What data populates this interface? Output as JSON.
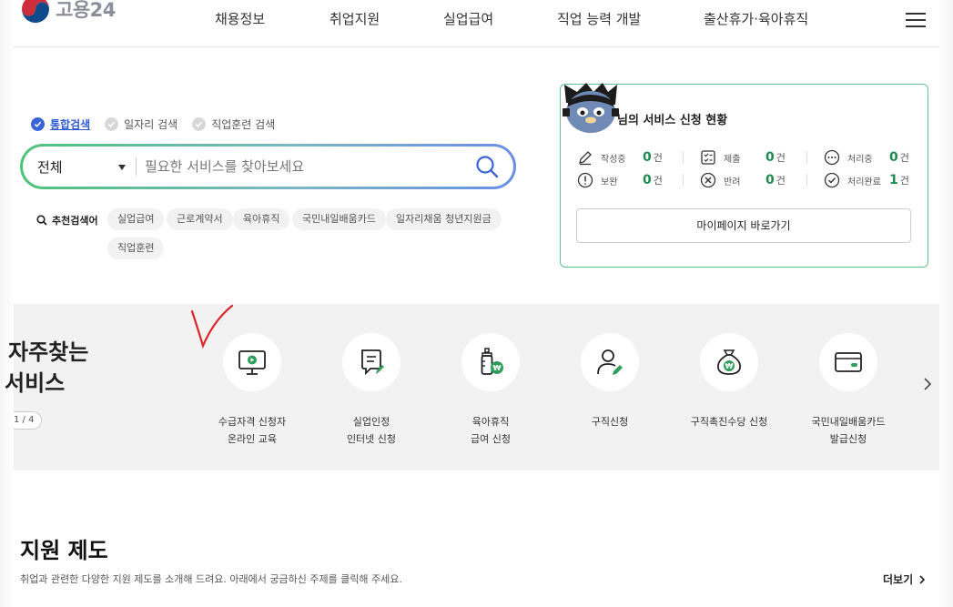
{
  "header": {
    "logo_text": "고용24",
    "nav": [
      "채용정보",
      "취업지원",
      "실업급여",
      "직업 능력 개발",
      "출산휴가·육아휴직"
    ]
  },
  "search": {
    "tabs": [
      {
        "label": "통합검색",
        "active": true
      },
      {
        "label": "일자리 검색",
        "active": false
      },
      {
        "label": "직업훈련 검색",
        "active": false
      }
    ],
    "select_value": "전체",
    "placeholder": "필요한 서비스를 찾아보세요",
    "recommend_label": "추천검색어",
    "recommend": [
      "실업급여",
      "근로계약서",
      "육아휴직",
      "국민내일배움카드",
      "일자리채움 청년지원금",
      "직업훈련"
    ]
  },
  "status": {
    "title": "님의 서비스 신청 현황",
    "unit": "건",
    "items": [
      {
        "label": "작성중",
        "value": "0"
      },
      {
        "label": "제출",
        "value": "0"
      },
      {
        "label": "처리중",
        "value": "0"
      },
      {
        "label": "보완",
        "value": "0"
      },
      {
        "label": "반려",
        "value": "0"
      },
      {
        "label": "처리완료",
        "value": "1"
      }
    ],
    "mypage_button": "마이페이지 바로가기"
  },
  "frequent": {
    "title_line1": "자주찾는",
    "title_line2": "서비스",
    "pager": "1 / 4",
    "services": [
      {
        "label": "수급자격 신청자\n온라인 교육",
        "icon": "monitor-play-icon"
      },
      {
        "label": "실업인정\n인터넷 신청",
        "icon": "document-pen-icon"
      },
      {
        "label": "육아휴직\n급여 신청",
        "icon": "baby-bottle-icon"
      },
      {
        "label": "구직신청",
        "icon": "person-pen-icon"
      },
      {
        "label": "구직촉진수당 신청",
        "icon": "money-bag-icon"
      },
      {
        "label": "국민내일배움카드\n발급신청",
        "icon": "card-icon"
      }
    ]
  },
  "support": {
    "title": "지원 제도",
    "description": "취업과 관련한 다양한 지원 제도를 소개해 드려요. 아래에서 궁금하신 주제를 클릭해 주세요.",
    "more": "더보기"
  },
  "colors": {
    "accent_green": "#1f8a4e",
    "card_border": "#5cc48a",
    "active_tab": "#2f5bd3",
    "annotation_red": "#d8262b"
  }
}
